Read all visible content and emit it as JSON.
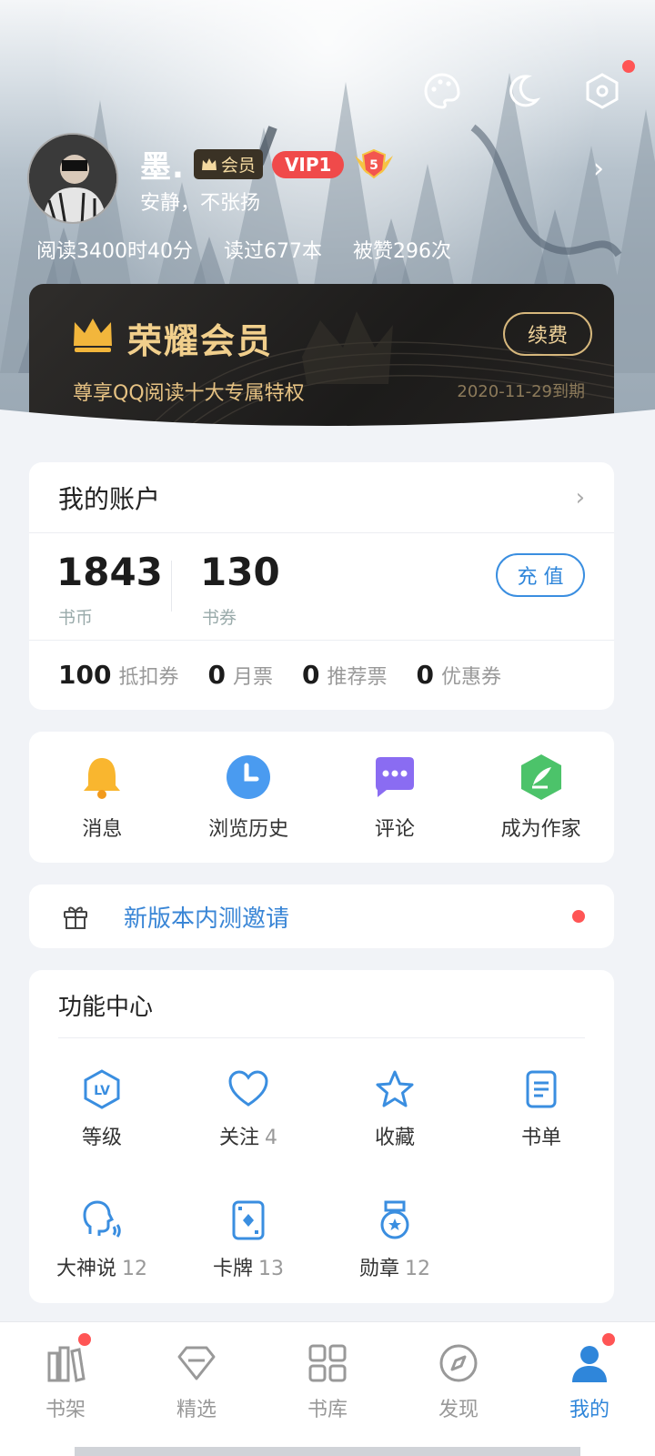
{
  "profile": {
    "nickname": "墨.",
    "member_badge": "会员",
    "vip_badge": "VIP1",
    "level_badge": "5",
    "signature": "安静，不张扬",
    "stats": [
      "阅读3400时40分",
      "读过677本",
      "被赞296次"
    ]
  },
  "vip_card": {
    "title": "荣耀会员",
    "subtitle": "尊享QQ阅读十大专属特权",
    "renew_label": "续费",
    "expiry": "2020-11-29到期"
  },
  "account": {
    "title": "我的账户",
    "coins": {
      "value": "1843",
      "label": "书币"
    },
    "vouchers": {
      "value": "130",
      "label": "书券"
    },
    "recharge_label": "充 值",
    "tickets": [
      {
        "value": "100",
        "label": "抵扣券"
      },
      {
        "value": "0",
        "label": "月票"
      },
      {
        "value": "0",
        "label": "推荐票"
      },
      {
        "value": "0",
        "label": "优惠券"
      }
    ]
  },
  "quick_actions": [
    {
      "label": "消息",
      "icon": "bell-icon"
    },
    {
      "label": "浏览历史",
      "icon": "clock-icon"
    },
    {
      "label": "评论",
      "icon": "chat-icon"
    },
    {
      "label": "成为作家",
      "icon": "pen-icon"
    }
  ],
  "invite": {
    "label": "新版本内测邀请",
    "icon": "gift-icon"
  },
  "function_center": {
    "title": "功能中心",
    "items": [
      {
        "label": "等级",
        "count": "",
        "icon": "level-icon"
      },
      {
        "label": "关注",
        "count": "4",
        "icon": "heart-icon"
      },
      {
        "label": "收藏",
        "count": "",
        "icon": "star-icon"
      },
      {
        "label": "书单",
        "count": "",
        "icon": "booklist-icon"
      },
      {
        "label": "大神说",
        "count": "12",
        "icon": "voice-icon"
      },
      {
        "label": "卡牌",
        "count": "13",
        "icon": "card-icon"
      },
      {
        "label": "勋章",
        "count": "12",
        "icon": "medal-icon"
      }
    ]
  },
  "tabs": [
    {
      "label": "书架",
      "icon": "bookshelf-icon",
      "badge": true
    },
    {
      "label": "精选",
      "icon": "diamond-icon",
      "badge": false
    },
    {
      "label": "书库",
      "icon": "grid-icon",
      "badge": false
    },
    {
      "label": "发现",
      "icon": "compass-icon",
      "badge": false
    },
    {
      "label": "我的",
      "icon": "user-icon",
      "badge": true,
      "active": true
    }
  ],
  "colors": {
    "accent": "#2f86da",
    "gold": "#f1cf8c",
    "red_dot": "#f55555"
  }
}
